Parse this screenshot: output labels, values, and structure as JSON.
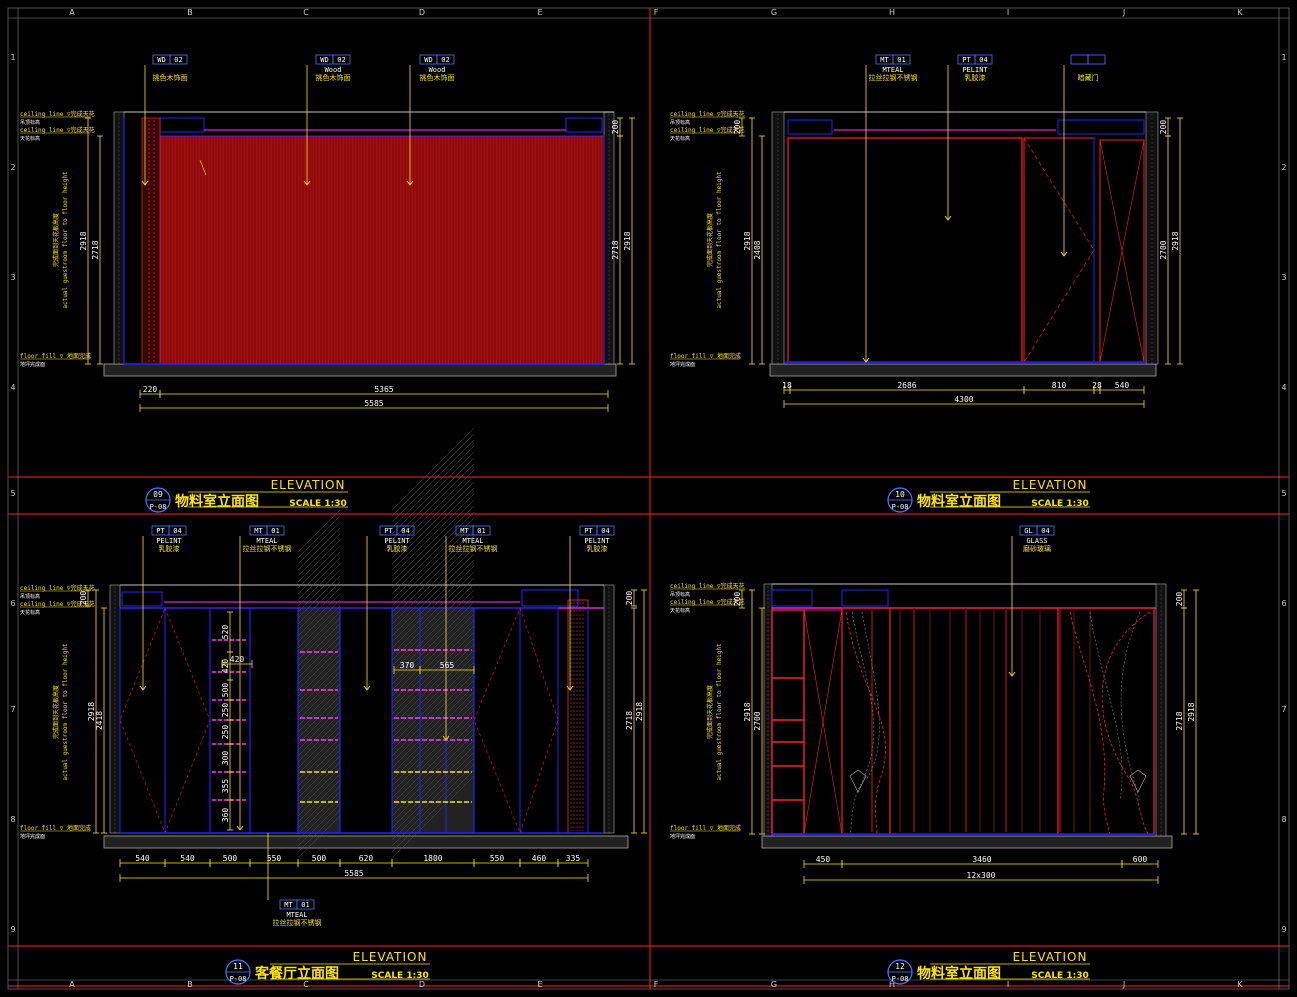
{
  "grid": {
    "letters": [
      "A",
      "B",
      "C",
      "D",
      "E",
      "F",
      "G",
      "H",
      "I",
      "J",
      "K"
    ],
    "numbers": [
      "1",
      "2",
      "3",
      "4",
      "5",
      "6",
      "7",
      "8",
      "9"
    ]
  },
  "colors": {
    "frame_red": "#ff2020",
    "yellow": "#ffe400",
    "blue": "#2222ff",
    "magenta": "#ff33ff",
    "wall_red": "#a50f0f",
    "white": "#ffffff"
  },
  "panels": [
    {
      "id": "p09",
      "bubble_num": "09",
      "bubble_ref": "P-08",
      "title": "物料室立面图",
      "elevation": "ELEVATION",
      "scale": "SCALE 1:30",
      "labels": [
        {
          "code": "WD",
          "num": "02",
          "en": "",
          "cn": "挑色木饰面"
        },
        {
          "code": "WD",
          "num": "02",
          "en": "Wood",
          "cn": "挑色木饰面"
        },
        {
          "code": "WD",
          "num": "02",
          "en": "Wood",
          "cn": "挑色木饰面"
        }
      ],
      "left_notes": {
        "ceiling1": "ceiling line ▽完成天花",
        "ceiling1_cn": "吊顶标高",
        "ceiling2": "ceiling line ▽完成天花",
        "ceiling2_cn": "天花标高",
        "floor": "floor fill ▽ 地面完成",
        "floor_cn": "地坪完成面",
        "v_cn": "完成面到天花板高度",
        "v_en": "actual guestroom floor to floor height"
      },
      "dims_v_left": [
        "2918",
        "2718"
      ],
      "dims_v_right": [
        "200",
        "2718",
        "2918"
      ],
      "dims_h": [
        "220",
        "5365"
      ],
      "dims_total": "5585"
    },
    {
      "id": "p10",
      "bubble_num": "10",
      "bubble_ref": "P-08",
      "title": "物料室立面图",
      "elevation": "ELEVATION",
      "scale": "SCALE 1:30",
      "labels": [
        {
          "code": "MT",
          "num": "01",
          "en": "MTEAL",
          "cn": "拉丝拉钢不锈钢"
        },
        {
          "code": "PT",
          "num": "04",
          "en": "PELINT",
          "cn": "乳胶漆"
        },
        {
          "code": "",
          "num": "",
          "en": "",
          "cn": "暗藏门"
        }
      ],
      "left_notes": {
        "ceiling1": "ceiling line ▽完成天花",
        "ceiling1_cn": "吊顶标高",
        "ceiling2": "ceiling line ▽完成天花",
        "ceiling2_cn": "天花标高",
        "floor": "floor fill ▽ 地面完成",
        "floor_cn": "地坪完成面",
        "v_cn": "完成面到天花板高度",
        "v_en": "actual guestroom floor to floor height"
      },
      "dims_v_left": [
        "200",
        "2918",
        "2408"
      ],
      "dims_v_right": [
        "200",
        "2700",
        "2918"
      ],
      "dims_h": [
        "18",
        "2686",
        "810",
        "28",
        "540"
      ],
      "dims_total": "4300"
    },
    {
      "id": "p11",
      "bubble_num": "11",
      "bubble_ref": "P-08",
      "title": "客餐厅立面图",
      "elevation": "ELEVATION",
      "scale": "SCALE 1:30",
      "labels": [
        {
          "code": "PT",
          "num": "04",
          "en": "PELINT",
          "cn": "乳胶漆"
        },
        {
          "code": "MT",
          "num": "01",
          "en": "MTEAL",
          "cn": "拉丝拉钢不锈钢"
        },
        {
          "code": "PT",
          "num": "04",
          "en": "PELINT",
          "cn": "乳胶漆"
        },
        {
          "code": "MT",
          "num": "01",
          "en": "MTEAL",
          "cn": "拉丝拉钢不锈钢"
        },
        {
          "code": "PT",
          "num": "04",
          "en": "PELINT",
          "cn": "乳胶漆"
        }
      ],
      "bottom_label": {
        "code": "MT",
        "num": "01",
        "en": "MTEAL",
        "cn": "拉丝拉钢不锈钢"
      },
      "left_notes": {
        "ceiling1": "ceiling line ▽完成天花",
        "ceiling1_cn": "吊顶标高",
        "ceiling2": "ceiling line ▽完成天花",
        "ceiling2_cn": "天花标高",
        "floor": "floor fill ▽ 地面完成",
        "floor_cn": "地坪完成面",
        "v_cn": "完成面到天花板高度",
        "v_en": "actual guestroom floor to floor height"
      },
      "dims_v_left": [
        "200",
        "2918",
        "2418"
      ],
      "dims_v_right": [
        "200",
        "2718",
        "2918"
      ],
      "dims_inner": [
        "520",
        "420",
        "500",
        "250",
        "250",
        "300",
        "355",
        "360",
        "370",
        "565"
      ],
      "dims_h": [
        "540",
        "540",
        "500",
        "550",
        "500",
        "620",
        "1800",
        "550",
        "460",
        "335"
      ],
      "dims_total": "5585"
    },
    {
      "id": "p12",
      "bubble_num": "12",
      "bubble_ref": "P-08",
      "title": "物料室立面图",
      "elevation": "ELEVATION",
      "scale": "SCALE 1:30",
      "labels": [
        {
          "code": "GL",
          "num": "04",
          "en": "GLASS",
          "cn": "磨砂玻璃"
        }
      ],
      "left_notes": {
        "ceiling1": "ceiling line ▽完成天花",
        "ceiling1_cn": "吊顶标高",
        "ceiling2": "ceiling line ▽完成天花",
        "ceiling2_cn": "天花标高",
        "floor": "floor fill ▽ 地面完成",
        "floor_cn": "地坪完成面",
        "v_cn": "完成面到天花板高度",
        "v_en": "actual guestroom floor to floor height"
      },
      "dims_v_left": [
        "200",
        "2918",
        "2700"
      ],
      "dims_v_right": [
        "200",
        "2718",
        "2918"
      ],
      "dims_h": [
        "450",
        "3460",
        "600"
      ],
      "dims_total": "12x300"
    }
  ]
}
